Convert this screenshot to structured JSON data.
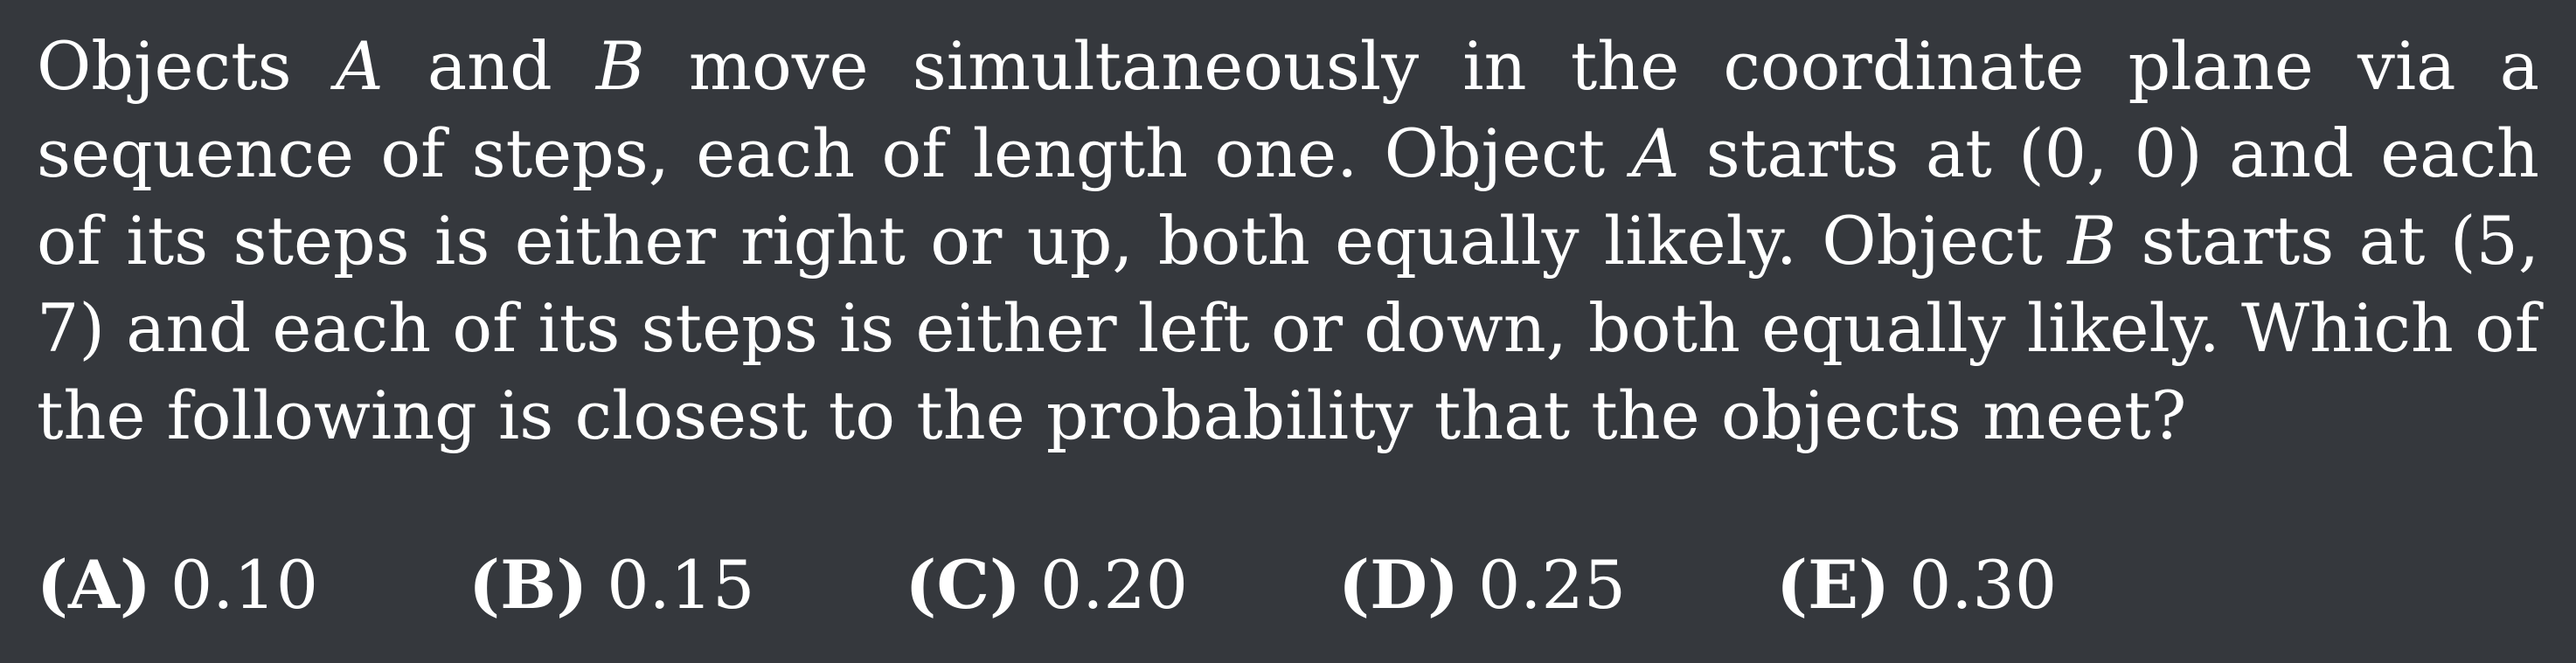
{
  "problem": {
    "segments": [
      {
        "t": "Objects ",
        "math": false
      },
      {
        "t": "A",
        "math": true
      },
      {
        "t": " and ",
        "math": false
      },
      {
        "t": "B",
        "math": true
      },
      {
        "t": " move simultaneously in the coordinate plane via a sequence of steps, each of length one. Object ",
        "math": false
      },
      {
        "t": "A",
        "math": true
      },
      {
        "t": " starts at (0, 0) and each of its steps is either right or up, both equally likely. Object ",
        "math": false
      },
      {
        "t": "B",
        "math": true
      },
      {
        "t": " starts at (5, 7) and each of its steps is either left or down, both equally likely. Which of the following is closest to the probability that the objects meet?",
        "math": false
      }
    ]
  },
  "choices": [
    {
      "letter": "(A)",
      "value": "0.10"
    },
    {
      "letter": "(B)",
      "value": "0.15"
    },
    {
      "letter": "(C)",
      "value": "0.20"
    },
    {
      "letter": "(D)",
      "value": "0.25"
    },
    {
      "letter": "(E)",
      "value": "0.30"
    }
  ]
}
